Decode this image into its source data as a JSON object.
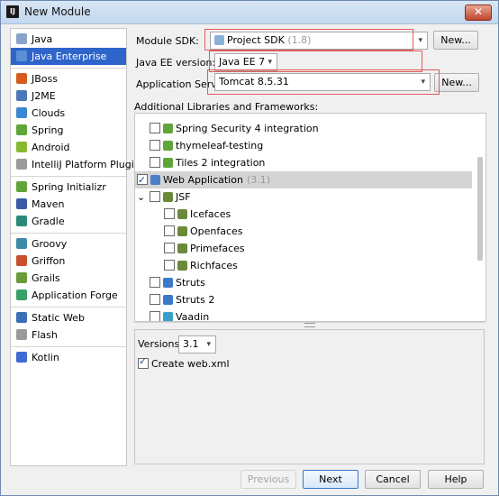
{
  "window": {
    "title": "New Module",
    "logo_text": "IJ",
    "close_glyph": "✕"
  },
  "sidebar": {
    "groups": [
      [
        {
          "label": "Java",
          "icon": "folder-icon",
          "color": "#8aa3c9"
        },
        {
          "label": "Java Enterprise",
          "icon": "java-ee-icon",
          "color": "#5d8fd6",
          "selected": true
        }
      ],
      [
        {
          "label": "JBoss",
          "icon": "jboss-icon",
          "color": "#d45a20"
        },
        {
          "label": "J2ME",
          "icon": "j2me-icon",
          "color": "#4b78b8"
        },
        {
          "label": "Clouds",
          "icon": "cloud-icon",
          "color": "#3c87d1"
        },
        {
          "label": "Spring",
          "icon": "spring-leaf-icon",
          "color": "#5fa53a"
        },
        {
          "label": "Android",
          "icon": "android-icon",
          "color": "#88b832"
        },
        {
          "label": "IntelliJ Platform Plugin",
          "icon": "plugin-icon",
          "color": "#9a9a9a"
        }
      ],
      [
        {
          "label": "Spring Initializr",
          "icon": "spring-initializr-icon",
          "color": "#5fa53a"
        },
        {
          "label": "Maven",
          "icon": "maven-icon",
          "color": "#3a5aa8"
        },
        {
          "label": "Gradle",
          "icon": "gradle-icon",
          "color": "#2b8a7a"
        }
      ],
      [
        {
          "label": "Groovy",
          "icon": "groovy-icon",
          "color": "#3e8aa8"
        },
        {
          "label": "Griffon",
          "icon": "griffon-icon",
          "color": "#c8502a"
        },
        {
          "label": "Grails",
          "icon": "grails-icon",
          "color": "#6a9a3a"
        },
        {
          "label": "Application Forge",
          "icon": "forge-icon",
          "color": "#3aa06a"
        }
      ],
      [
        {
          "label": "Static Web",
          "icon": "globe-icon",
          "color": "#3a6fb6"
        },
        {
          "label": "Flash",
          "icon": "flash-folder-icon",
          "color": "#9a9a9a"
        }
      ],
      [
        {
          "label": "Kotlin",
          "icon": "kotlin-icon",
          "color": "#3e6ad2"
        }
      ]
    ]
  },
  "form": {
    "module_sdk": {
      "label": "Module SDK:",
      "value": "Project SDK",
      "value_hint": "(1.8)",
      "button": "New..."
    },
    "java_ee_version": {
      "label": "Java EE version:",
      "value": "Java EE 7"
    },
    "app_server": {
      "label": "Application Server:",
      "value": "Tomcat 8.5.31",
      "button": "New..."
    },
    "libraries_label": "Additional Libraries and Frameworks:"
  },
  "libraries": [
    {
      "label": "Spring Security 4 integration",
      "indent": 1,
      "checked": false,
      "icon": "spring-leaf-icon",
      "color": "#5fa53a"
    },
    {
      "label": "thymeleaf-testing",
      "indent": 1,
      "checked": false,
      "icon": "spring-leaf-icon",
      "color": "#5fa53a"
    },
    {
      "label": "Tiles 2 integration",
      "indent": 1,
      "checked": false,
      "icon": "spring-leaf-icon",
      "color": "#5fa53a"
    },
    {
      "label": "Web Application",
      "hint": "(3.1)",
      "indent": 0,
      "checked": true,
      "icon": "web-app-icon",
      "color": "#4a7ec9",
      "selected": true
    },
    {
      "label": "JSF",
      "indent": 1,
      "checked": false,
      "icon": "jsf-icon",
      "color": "#6a8a3a",
      "expand": "⌄"
    },
    {
      "label": "Icefaces",
      "indent": 2,
      "checked": false,
      "icon": "jsf-icon",
      "color": "#6a8a3a"
    },
    {
      "label": "Openfaces",
      "indent": 2,
      "checked": false,
      "icon": "jsf-icon",
      "color": "#6a8a3a"
    },
    {
      "label": "Primefaces",
      "indent": 2,
      "checked": false,
      "icon": "jsf-icon",
      "color": "#6a8a3a"
    },
    {
      "label": "Richfaces",
      "indent": 2,
      "checked": false,
      "icon": "jsf-icon",
      "color": "#6a8a3a"
    },
    {
      "label": "Struts",
      "indent": 1,
      "checked": false,
      "icon": "struts-gear-icon",
      "color": "#3a7ac9"
    },
    {
      "label": "Struts 2",
      "indent": 1,
      "checked": false,
      "icon": "struts-gear-icon",
      "color": "#3a7ac9"
    },
    {
      "label": "Vaadin",
      "indent": 1,
      "checked": false,
      "icon": "vaadin-icon",
      "color": "#3aa0c9"
    }
  ],
  "details": {
    "versions_label": "Versions:",
    "version_value": "3.1",
    "create_xml_label": "Create web.xml",
    "create_xml_checked": true
  },
  "buttons": {
    "previous": "Previous",
    "next": "Next",
    "cancel": "Cancel",
    "help": "Help"
  }
}
